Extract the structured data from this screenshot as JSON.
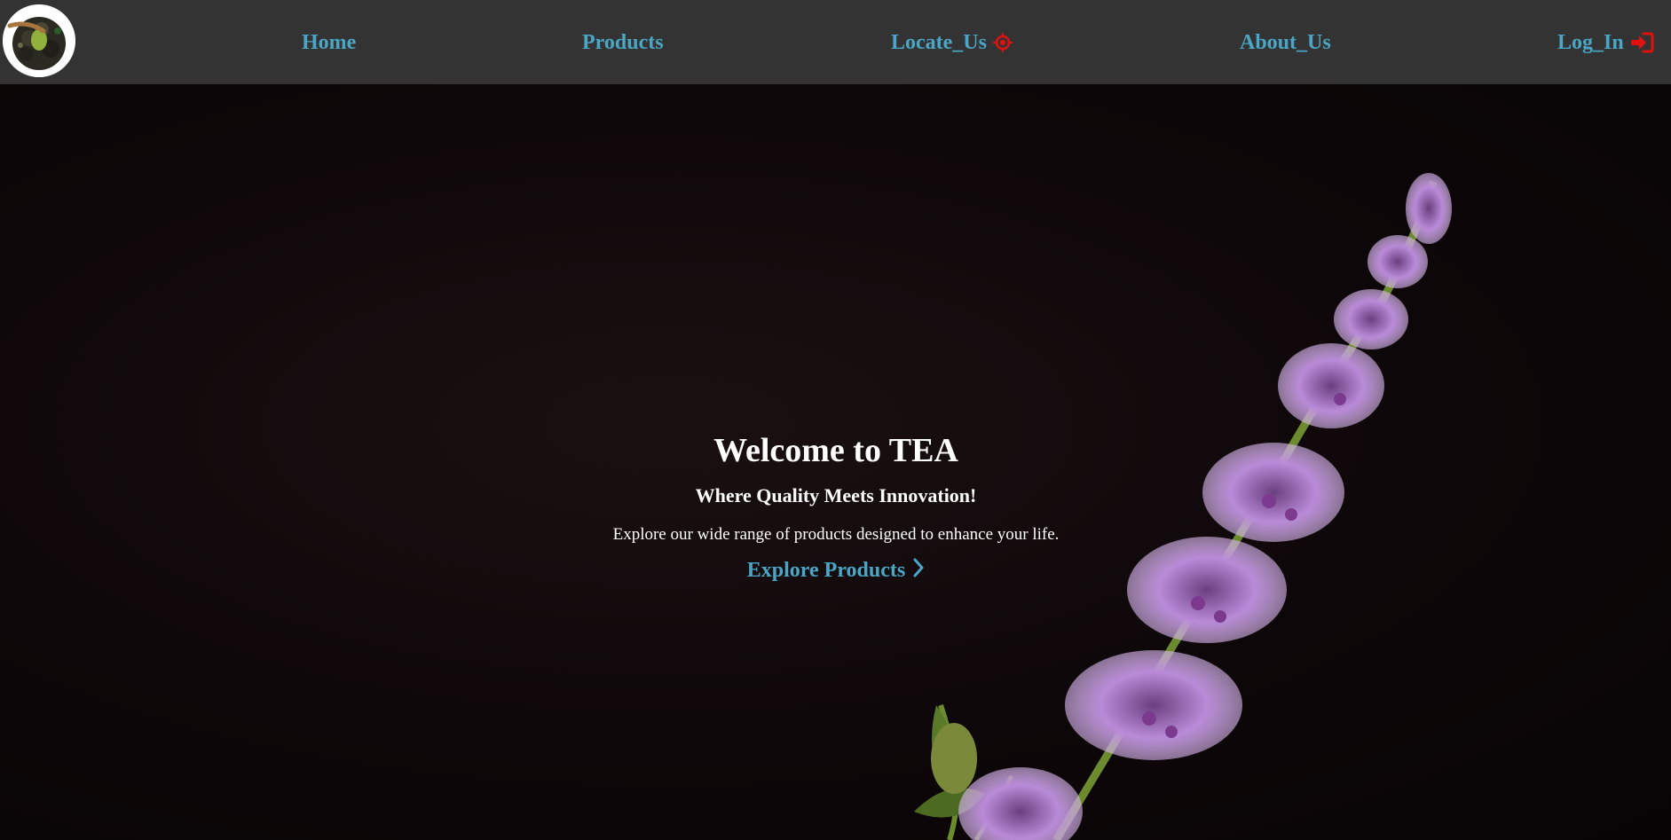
{
  "nav": {
    "logo_alt": "tea leaves logo",
    "links": [
      {
        "label": "Home"
      },
      {
        "label": "Products"
      },
      {
        "label": "Locate_Us",
        "icon": "crosshair-icon"
      },
      {
        "label": "About_Us"
      },
      {
        "label": "Log_In",
        "icon": "sign-in-icon"
      }
    ]
  },
  "hero": {
    "title": "Welcome to TEA",
    "subtitle": "Where Quality Meets Innovation!",
    "text": "Explore our wide range of products designed to enhance your life.",
    "cta_label": "Explore Products",
    "cta_icon": "chevron-right-icon"
  },
  "colors": {
    "nav_bg": "#333333",
    "link": "#4aa6c4",
    "icon_accent": "#e01010",
    "hero_bg": "#0d0708",
    "flower": "#b98ad8"
  }
}
